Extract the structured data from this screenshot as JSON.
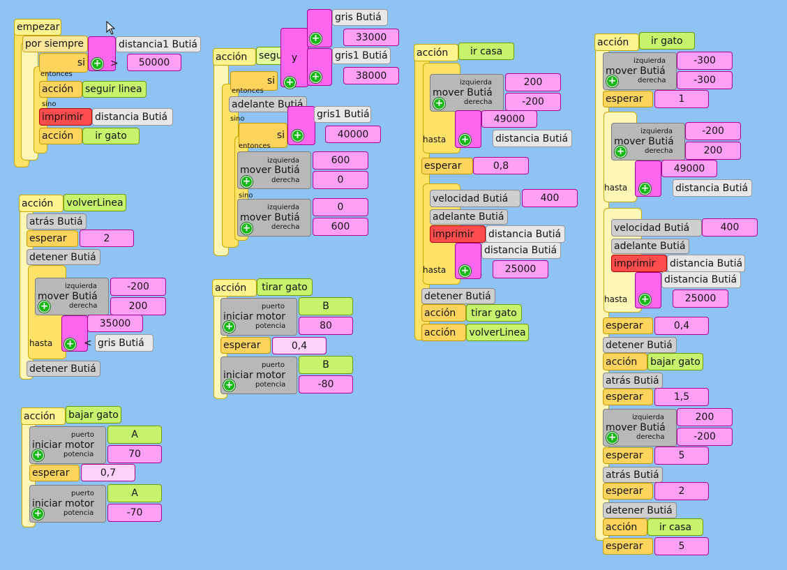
{
  "stack_empezar": {
    "start": "empezar",
    "forever": "por siempre",
    "if": "si",
    "sensor": "distancia1 Butiá",
    "gt": ">",
    "value": "50000",
    "then": "entonces",
    "action1": "acción",
    "action1_name": "seguir linea",
    "else": "sino",
    "print": "imprimir",
    "print_sensor": "distancia Butiá",
    "action2": "acción",
    "action2_name": "ir gato"
  },
  "stack_seguir": {
    "action": "acción",
    "name": "segu",
    "if": "si",
    "and": "y",
    "sensor1": "gris Butiá",
    "value1": "33000",
    "sensor2": "gris1 Butiá",
    "value2": "38000",
    "then": "entonces",
    "forward": "adelante Butiá",
    "else": "sino",
    "if2": "si",
    "sensor3": "gris1 Butiá",
    "value3": "40000",
    "then2": "entonces",
    "move": "mover Butiá",
    "left": "izquierda",
    "right": "derecha",
    "m1_left": "600",
    "m1_right": "0",
    "else2": "sino",
    "m2_left": "0",
    "m2_right": "600"
  },
  "stack_tirar": {
    "action": "acción",
    "name": "tirar gato",
    "motor": "iniciar motor",
    "port": "puerto",
    "power": "potencia",
    "m1_port": "B",
    "m1_power": "80",
    "wait": "esperar",
    "wait_value": "0,4",
    "m2_port": "B",
    "m2_power": "-80"
  },
  "stack_volver": {
    "action": "acción",
    "name": "volverLinea",
    "back": "atrás Butiá",
    "wait": "esperar",
    "wait_value": "2",
    "stop": "detener Butiá",
    "move": "mover Butiá",
    "left": "izquierda",
    "right": "derecha",
    "m_left": "-200",
    "m_right": "200",
    "until": "hasta",
    "value": "35000",
    "lt": "<",
    "sensor": "gris Butiá",
    "stop2": "detener Butiá"
  },
  "stack_bajar": {
    "action": "acción",
    "name": "bajar gato",
    "motor": "iniciar motor",
    "port": "puerto",
    "power": "potencia",
    "m1_port": "A",
    "m1_power": "70",
    "wait": "esperar",
    "wait_value": "0,7",
    "m2_port": "A",
    "m2_power": "-70"
  },
  "stack_ircasa": {
    "action": "acción",
    "name": "ir casa",
    "move": "mover Butiá",
    "left": "izquierda",
    "right": "derecha",
    "m_left": "200",
    "m_right": "-200",
    "until": "hasta",
    "value1": "49000",
    "sensor1": "distancia Butiá",
    "wait": "esperar",
    "wait_value": "0,8",
    "speed": "velocidad Butiá",
    "speed_value": "400",
    "forward": "adelante Butiá",
    "print": "imprimir",
    "print_sensor": "distancia Butiá",
    "sensor2": "distancia Butiá",
    "until2": "hasta",
    "value2": "25000",
    "stop": "detener Butiá",
    "a1": "acción",
    "a1_name": "tirar gato",
    "a2": "acción",
    "a2_name": "volverLinea"
  },
  "stack_irgato": {
    "action": "acción",
    "name": "ir gato",
    "move": "mover Butiá",
    "left": "izquierda",
    "right": "derecha",
    "m1_left": "-300",
    "m1_right": "-300",
    "wait1": "esperar",
    "wait1_value": "1",
    "m2_left": "-200",
    "m2_right": "200",
    "until": "hasta",
    "value1": "49000",
    "sensor1": "distancia Butiá",
    "speed": "velocidad Butiá",
    "speed_value": "400",
    "forward": "adelante Butiá",
    "print": "imprimir",
    "print_sensor": "distancia Butiá",
    "sensor2": "distancia Butiá",
    "until2": "hasta",
    "value2": "25000",
    "wait2": "esperar",
    "wait2_value": "0,4",
    "stop": "detener Butiá",
    "a1": "acción",
    "a1_name": "bajar gato",
    "back": "atrás Butiá",
    "wait3": "esperar",
    "wait3_value": "1,5",
    "m3_left": "200",
    "m3_right": "-200",
    "wait4": "esperar",
    "wait4_value": "5",
    "back2": "atrás Butiá",
    "wait5": "esperar",
    "wait5_value": "2",
    "stop2": "detener Butiá",
    "a2": "acción",
    "a2_name": "ir casa",
    "wait6": "esperar",
    "wait6_value": "5"
  },
  "icons": {
    "plus": "+",
    "cursor": "mouse-cursor-icon"
  },
  "colors": {
    "background": "#8fc3f4",
    "hat": "#fff38f",
    "flow": "#ffd45c",
    "number": "#ff9ff5",
    "string": "#c6f36b",
    "sensor": "#cfcfcf",
    "print": "#ff4d4d"
  }
}
